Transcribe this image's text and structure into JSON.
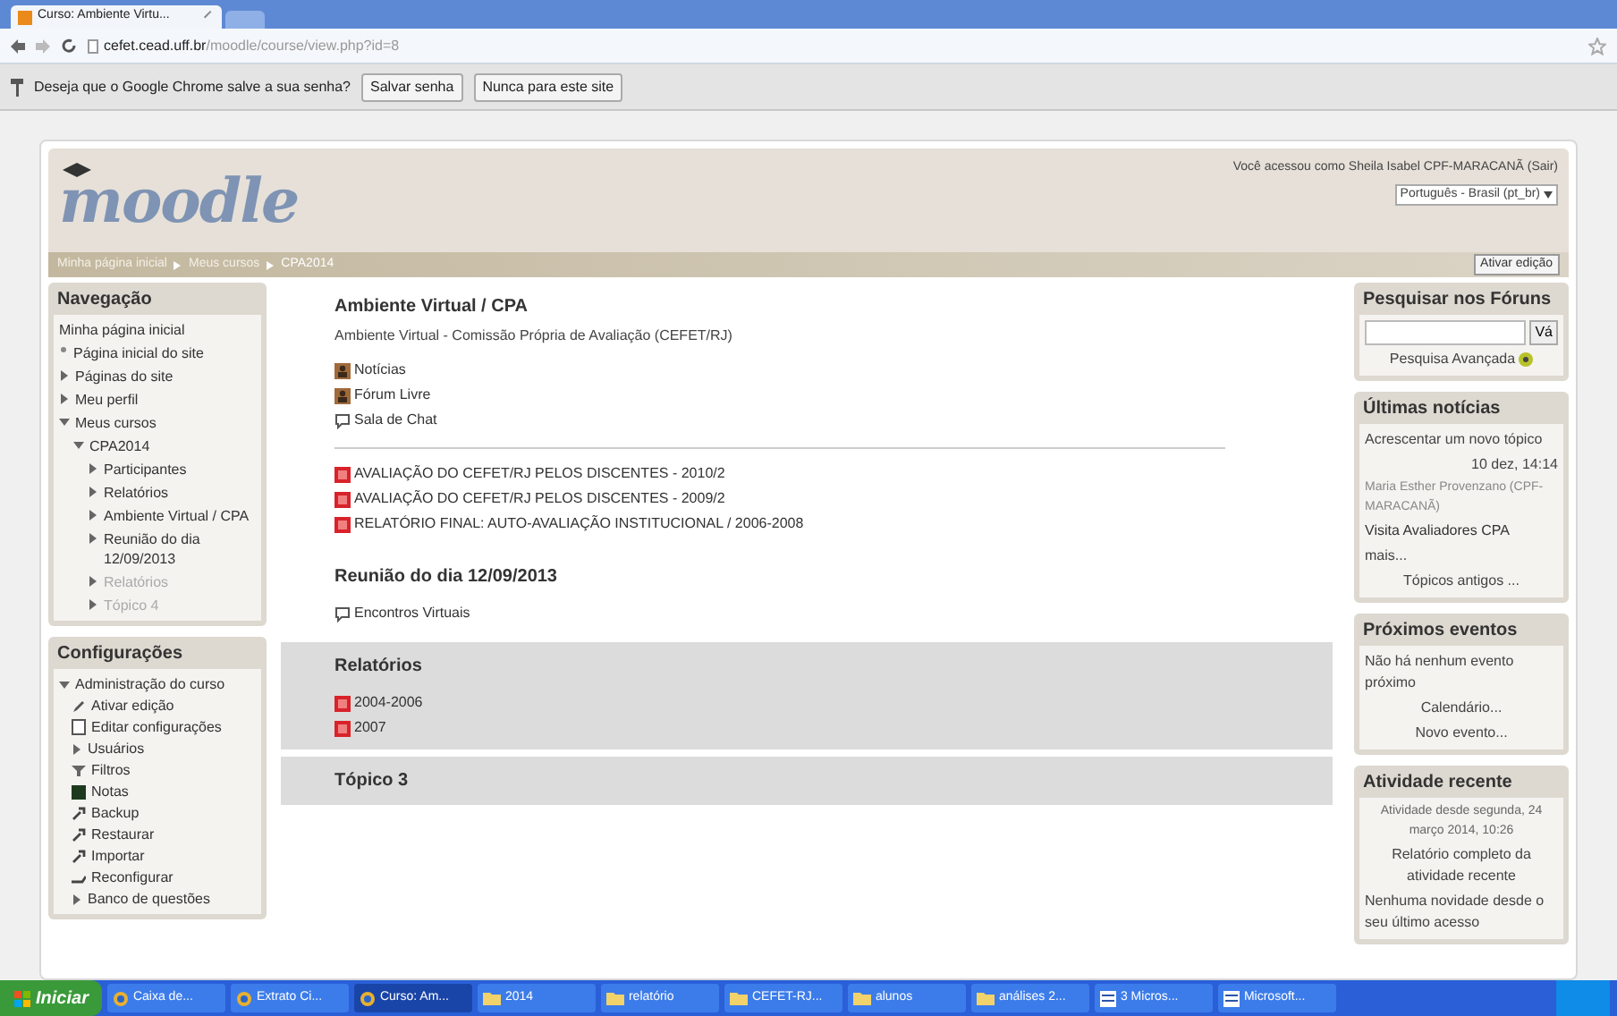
{
  "browser": {
    "tab_title": "Curso: Ambiente Virtu...",
    "url_host": "cefet.cead.uff.br",
    "url_path": "/moodle/course/view.php?id=8",
    "infobar": {
      "message": "Deseja que o Google Chrome salve a sua senha?",
      "buttons": [
        "Salvar senha",
        "Nunca para este site"
      ]
    }
  },
  "header": {
    "logo": "moodle",
    "login_info": "Você acessou como Sheila Isabel CPF-MARACANÃ (Sair)",
    "language": "Português - Brasil (pt_br)"
  },
  "breadcrumb": [
    "Minha página inicial",
    "Meus cursos",
    "CPA2014"
  ],
  "edit_button": "Ativar edição",
  "navigation": {
    "title": "Navegação",
    "items": [
      {
        "label": "Minha página inicial",
        "kind": "root",
        "dimmed": false
      },
      {
        "label": "Página inicial do site",
        "kind": "leaf",
        "dimmed": false
      },
      {
        "label": "Páginas do site",
        "kind": "branch",
        "expanded": false,
        "dimmed": false
      },
      {
        "label": "Meu perfil",
        "kind": "branch",
        "expanded": false,
        "dimmed": false
      },
      {
        "label": "Meus cursos",
        "kind": "branch",
        "expanded": true,
        "dimmed": false,
        "children": [
          {
            "label": "CPA2014",
            "kind": "branch",
            "expanded": true,
            "dimmed": false,
            "children": [
              {
                "label": "Participantes",
                "kind": "branch",
                "expanded": false,
                "dimmed": false
              },
              {
                "label": "Relatórios",
                "kind": "branch",
                "expanded": false,
                "dimmed": false
              },
              {
                "label": "Ambiente Virtual / CPA",
                "kind": "branch",
                "expanded": false,
                "dimmed": false
              },
              {
                "label": "Reunião do dia 12/09/2013",
                "kind": "branch",
                "expanded": false,
                "dimmed": false
              },
              {
                "label": "Relatórios",
                "kind": "branch",
                "expanded": false,
                "dimmed": true
              },
              {
                "label": "Tópico 4",
                "kind": "branch",
                "expanded": false,
                "dimmed": true
              }
            ]
          }
        ]
      }
    ]
  },
  "settings": {
    "title": "Configurações",
    "items": [
      {
        "label": "Administração do curso",
        "kind": "branch",
        "expanded": true,
        "children": [
          {
            "label": "Ativar edição",
            "kind": "pencil"
          },
          {
            "label": "Editar configurações",
            "kind": "doc"
          },
          {
            "label": "Usuários",
            "kind": "branch",
            "expanded": false
          },
          {
            "label": "Filtros",
            "kind": "funnel"
          },
          {
            "label": "Notas",
            "kind": "grades"
          },
          {
            "label": "Backup",
            "kind": "tool"
          },
          {
            "label": "Restaurar",
            "kind": "tool"
          },
          {
            "label": "Importar",
            "kind": "tool"
          },
          {
            "label": "Reconfigurar",
            "kind": "reset"
          },
          {
            "label": "Banco de questões",
            "kind": "branch",
            "expanded": false
          }
        ]
      }
    ]
  },
  "sections": [
    {
      "title": "Ambiente Virtual / CPA",
      "summary": "Ambiente Virtual - Comissão Própria de Avaliação (CEFET/RJ)",
      "shaded": false,
      "groups": [
        [
          {
            "label": "Notícias",
            "kind": "forum"
          },
          {
            "label": "Fórum Livre",
            "kind": "forum"
          },
          {
            "label": "Sala de Chat",
            "kind": "chat"
          }
        ],
        [
          {
            "label": "AVALIAÇÃO DO CEFET/RJ PELOS DISCENTES - 2010/2",
            "kind": "pdf"
          },
          {
            "label": "AVALIAÇÃO DO CEFET/RJ PELOS DISCENTES - 2009/2",
            "kind": "pdf"
          },
          {
            "label": "RELATÓRIO FINAL: AUTO-AVALIAÇÃO INSTITUCIONAL / 2006-2008",
            "kind": "pdf"
          }
        ]
      ]
    },
    {
      "title": "Reunião do dia 12/09/2013",
      "shaded": false,
      "groups": [
        [
          {
            "label": "Encontros Virtuais",
            "kind": "chat"
          }
        ]
      ]
    },
    {
      "title": "Relatórios",
      "shaded": true,
      "groups": [
        [
          {
            "label": "2004-2006",
            "kind": "pdf"
          },
          {
            "label": "2007",
            "kind": "pdf"
          }
        ]
      ]
    },
    {
      "title": "Tópico 3",
      "shaded": true
    }
  ],
  "forum_search": {
    "title": "Pesquisar nos Fóruns",
    "button": "Vá",
    "advanced": "Pesquisa Avançada"
  },
  "latest_news": {
    "title": "Últimas notícias",
    "add": "Acrescentar um novo tópico",
    "date": "10 dez, 14:14",
    "author": "Maria Esther Provenzano (CPF-MARACANÃ)",
    "headline": "Visita Avaliadores CPA",
    "more": "mais...",
    "older": "Tópicos antigos ..."
  },
  "upcoming": {
    "title": "Próximos eventos",
    "empty": "Não há nenhum evento próximo",
    "links": [
      "Calendário...",
      "Novo evento..."
    ]
  },
  "recent": {
    "title": "Atividade recente",
    "since": "Atividade desde segunda, 24 março 2014, 10:26",
    "report": "Relatório completo da atividade recente",
    "none": "Nenhuma novidade desde o seu último acesso"
  },
  "taskbar": {
    "start": "Iniciar",
    "tasks": [
      {
        "label": "Caixa de...",
        "kind": "browser",
        "selected": false
      },
      {
        "label": "Extrato Ci...",
        "kind": "browser",
        "selected": false
      },
      {
        "label": "Curso: Am...",
        "kind": "browser",
        "selected": true
      },
      {
        "label": "2014",
        "kind": "folder",
        "selected": false
      },
      {
        "label": "relatório",
        "kind": "folder",
        "selected": false
      },
      {
        "label": "CEFET-RJ...",
        "kind": "folder",
        "selected": false
      },
      {
        "label": "alunos",
        "kind": "folder",
        "selected": false
      },
      {
        "label": "análises 2...",
        "kind": "folder",
        "selected": false
      },
      {
        "label": "3 Micros...",
        "kind": "word",
        "selected": false
      },
      {
        "label": "Microsoft...",
        "kind": "word",
        "selected": false
      }
    ]
  }
}
